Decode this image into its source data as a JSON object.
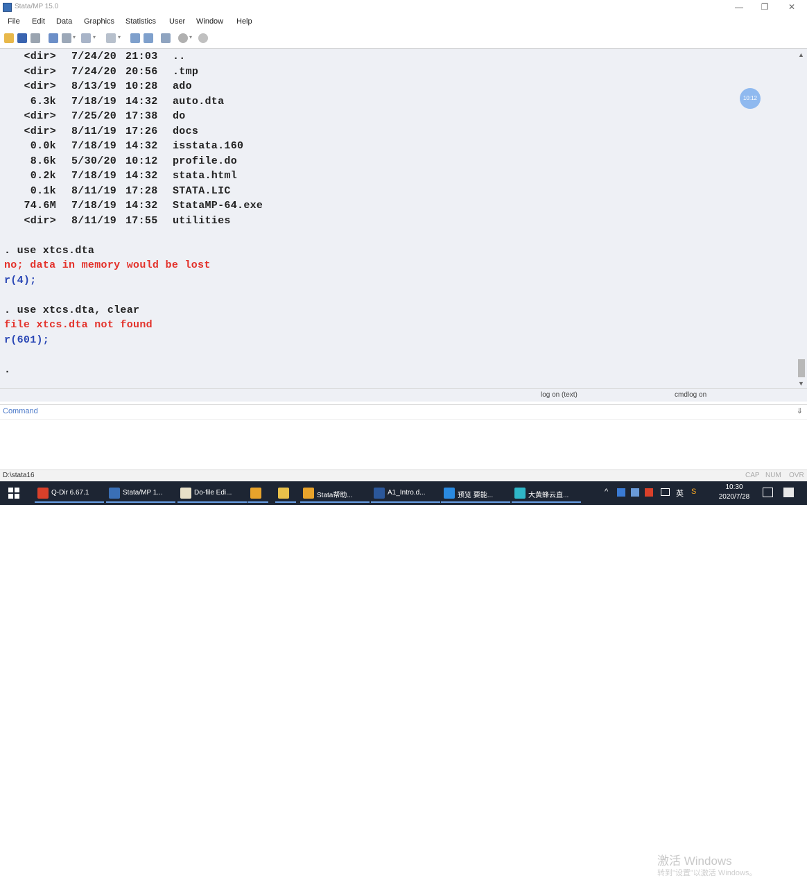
{
  "window": {
    "title": "Stata/MP 15.0",
    "minimize": "—",
    "restore": "❐",
    "close": "✕"
  },
  "menu": [
    "File",
    "Edit",
    "Data",
    "Graphics",
    "Statistics",
    "User",
    "Window",
    "Help"
  ],
  "toolbar": {
    "icons": [
      "open-icon",
      "save-icon",
      "print-icon",
      "log-icon",
      "viewer-icon",
      "graph-icon",
      "do-file-editor-icon",
      "data-editor-icon",
      "data-browser-icon",
      "variables-manager-icon",
      "more-icon",
      "break-icon"
    ]
  },
  "results": {
    "dir_listing": [
      {
        "size": "<dir>",
        "date": "7/24/20",
        "time": "21:03",
        "name": ".."
      },
      {
        "size": "<dir>",
        "date": "7/24/20",
        "time": "20:56",
        "name": ".tmp"
      },
      {
        "size": "<dir>",
        "date": "8/13/19",
        "time": "10:28",
        "name": "ado"
      },
      {
        "size": "6.3k",
        "date": "7/18/19",
        "time": "14:32",
        "name": "auto.dta"
      },
      {
        "size": "<dir>",
        "date": "7/25/20",
        "time": "17:38",
        "name": "do"
      },
      {
        "size": "<dir>",
        "date": "8/11/19",
        "time": "17:26",
        "name": "docs"
      },
      {
        "size": "0.0k",
        "date": "7/18/19",
        "time": "14:32",
        "name": "isstata.160"
      },
      {
        "size": "8.6k",
        "date": "5/30/20",
        "time": "10:12",
        "name": "profile.do"
      },
      {
        "size": "0.2k",
        "date": "7/18/19",
        "time": "14:32",
        "name": "stata.html"
      },
      {
        "size": "0.1k",
        "date": "8/11/19",
        "time": "17:28",
        "name": "STATA.LIC"
      },
      {
        "size": "74.6M",
        "date": "7/18/19",
        "time": "14:32",
        "name": "StataMP-64.exe"
      },
      {
        "size": "<dir>",
        "date": "8/11/19",
        "time": "17:55",
        "name": "utilities"
      }
    ],
    "cmd1": ". use xtcs.dta",
    "err1": "no; data in memory would be lost",
    "rc1": "r(4);",
    "cmd2": ". use xtcs.dta, clear",
    "err2": "file xtcs.dta not found",
    "rc2": "r(601);",
    "prompt": "."
  },
  "overlay_bubble": "10:12",
  "status": {
    "log": "log on (text)",
    "cmdlog": "cmdlog on"
  },
  "command": {
    "label": "Command",
    "pin": "⇓"
  },
  "watermark": {
    "line1": "激活 Windows",
    "line2": "转到\"设置\"以激活 Windows。"
  },
  "statusbar": {
    "path": "D:\\stata16",
    "cap": "CAP",
    "num": "NUM",
    "ovr": "OVR"
  },
  "taskbar": {
    "items": [
      {
        "label": "Q-Dir 6.67.1",
        "icon": "q-dir-icon",
        "color": "#d9402a"
      },
      {
        "label": "Stata/MP 1...",
        "icon": "stata-icon",
        "color": "#3a6fb5"
      },
      {
        "label": "Do-file Edi...",
        "icon": "do-file-icon",
        "color": "#e8e0c8"
      },
      {
        "label": "",
        "icon": "search-app-icon",
        "color": "#e8a32b"
      },
      {
        "label": "",
        "icon": "folder-icon",
        "color": "#e8c04a"
      },
      {
        "label": "Stata帮助...",
        "icon": "chrome-icon",
        "color": "#e8a32b"
      },
      {
        "label": "A1_Intro.d...",
        "icon": "word-icon",
        "color": "#2b579a"
      },
      {
        "label": "预览 要能...",
        "icon": "vscode-icon",
        "color": "#2a8ae0"
      },
      {
        "label": "大黄蜂云直...",
        "icon": "cloud-icon",
        "color": "#2fb7c8"
      }
    ],
    "tray": [
      "^",
      "英",
      "S"
    ],
    "time": "10:30",
    "date": "2020/7/28"
  }
}
